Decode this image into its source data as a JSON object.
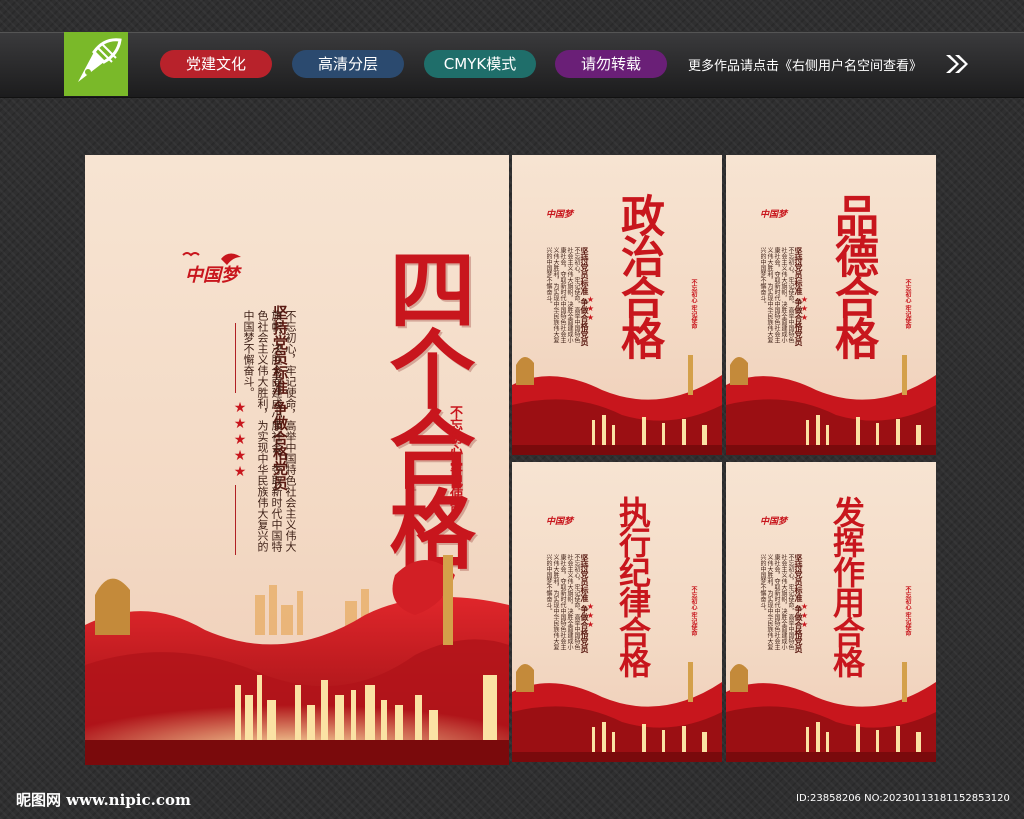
{
  "header": {
    "tags": [
      "党建文化",
      "高清分层",
      "CMYK模式",
      "请勿转载"
    ],
    "more_text": "更多作品请点击《右侧用户名空间查看》",
    "tag_colors": [
      "#b8222b",
      "#2b4a6f",
      "#1f6e6a",
      "#6a1f77"
    ]
  },
  "logo_icon": "pen-nib-icon",
  "main_poster": {
    "title": "四个合格",
    "logo_text": "中国梦",
    "slogan": "坚持党员标准 争做合格党员",
    "body": "不忘初心，牢记使命，高举中国特色社会主义伟大旗帜，决胜全面建成小康社会，夺取新时代中国特色社会主义伟大胜利，为实现中华民族伟大复兴的中国梦不懈奋斗。",
    "seal": "不忘初心 牢记使命"
  },
  "small_posters": [
    {
      "title": "政治合格",
      "slogan": "坚持党员标准 争做合格党员",
      "seal": "不忘初心 牢记使命"
    },
    {
      "title": "品德合格",
      "slogan": "坚持党员标准 争做合格党员",
      "seal": "不忘初心 牢记使命"
    },
    {
      "title": "执行纪律合格",
      "slogan": "坚持党员标准 争做合格党员",
      "seal": "不忘初心 牢记使命"
    },
    {
      "title": "发挥作用合格",
      "slogan": "坚持党员标准 争做合格党员",
      "seal": "不忘初心 牢记使命"
    }
  ],
  "small_body": "不忘初心，牢记使命，高举中国特色社会主义伟大旗帜，决胜全面建成小康社会，夺取新时代中国特色社会主义伟大胜利，为实现中华民族伟大复兴的中国梦不懈奋斗。",
  "small_logo_text": "中国梦",
  "footer": {
    "site": "昵图网 www.nipic.com",
    "id": "ID:23858206 NO:20230113181152853120"
  },
  "colors": {
    "accent": "#c8161d",
    "poster_bg": "#f5dfcb",
    "green": "#7ab929"
  }
}
